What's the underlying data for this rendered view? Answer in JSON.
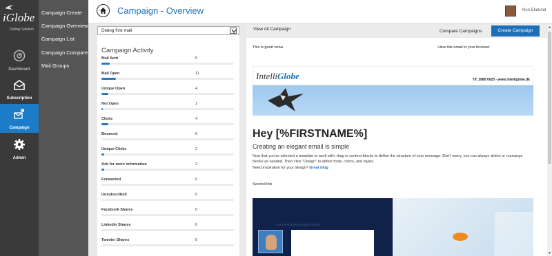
{
  "brand": {
    "logo_text": "iGlobe",
    "tagline": "Dialing Solution"
  },
  "rail": [
    {
      "label": "Dashboard",
      "icon": "dashboard-icon"
    },
    {
      "label": "Subscription",
      "icon": "envelope-icon"
    },
    {
      "label": "Campaign",
      "icon": "megaphone-mail-icon"
    },
    {
      "label": "Admin",
      "icon": "gear-icon"
    }
  ],
  "submenu": [
    "Campaign Create",
    "Campaign Overview",
    "Campaign List",
    "Campaign Compare",
    "Mail Groups"
  ],
  "header": {
    "title": "Campaign - Overview",
    "user_name": "Alon Ekelund"
  },
  "dropdown": {
    "selected": "Dialog first mail"
  },
  "activity": {
    "title": "Campaign Activity",
    "rows": [
      {
        "name": "Mail Sent",
        "value": "5",
        "fraction": 0.06
      },
      {
        "name": "Mail Open",
        "value": "11",
        "fraction": 0.11
      },
      {
        "name": "Unique Open",
        "value": "4",
        "fraction": 0.05
      },
      {
        "name": "Not Open",
        "value": "1",
        "fraction": 0.01
      },
      {
        "name": "Clicks",
        "value": "4",
        "fraction": 0.05
      },
      {
        "name": "Bounced",
        "value": "0",
        "fraction": 0
      },
      {
        "name": "Unique Clicks",
        "value": "2",
        "fraction": 0.02
      },
      {
        "name": "Ask for more information",
        "value": "2",
        "fraction": 0.02
      },
      {
        "name": "Forwarded",
        "value": "0",
        "fraction": 0
      },
      {
        "name": "Unsubscribed",
        "value": "0",
        "fraction": 0
      },
      {
        "name": "Facebook Shares",
        "value": "0",
        "fraction": 0
      },
      {
        "name": "Linkedin Shares",
        "value": "0",
        "fraction": 0
      },
      {
        "name": "Tweeter Shares",
        "value": "0",
        "fraction": 0
      }
    ]
  },
  "toolbar": {
    "view_all": "View All Campaign",
    "compare": "Compare Campaigns",
    "create": "Create Campaign"
  },
  "email": {
    "top_left": "This is great news",
    "top_right": "View this email in your browser",
    "logo_a": "Intelli",
    "logo_b": "Globe",
    "contact": "Tlf. 2880 0025 - www.intelliglobe.dk",
    "greeting": "Hey [%FIRSTNAME%]",
    "subheading": "Creating an elegant email is simple",
    "body": "Now that you've selected a template to work with, drag in content blocks to define the structure of your message. Don't worry, you can always delete or rearrange blocks as needed. Then click \"Design\" to define fonts, colors, and styles.",
    "inspire_prefix": "Need inspiration for your design?",
    "inspire_link": "Great blog",
    "second_link": "Second link"
  }
}
